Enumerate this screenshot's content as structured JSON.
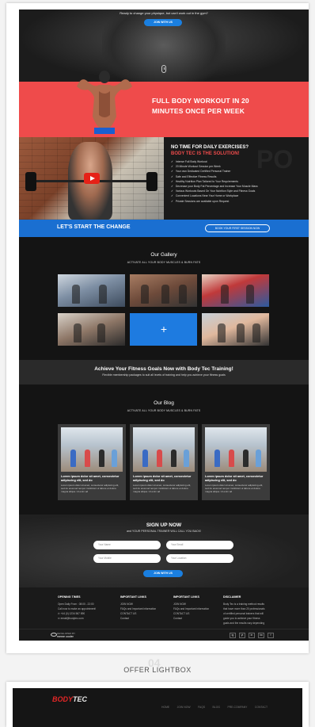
{
  "hero": {
    "subtitle": "Ready to change your physique, but can't work out in the gym?",
    "button": "JOIN WITH US"
  },
  "workout": {
    "title": "FULL BODY WORKOUT IN 20 MINUTES ONCE PER WEEK"
  },
  "notime": {
    "title": "NO TIME FOR DAILY EXERCISES?",
    "subtitle": "BODY TEC IS THE SOLUTION!",
    "bg_text": "PO",
    "items": [
      "Intense Full Body Workout",
      "20 Minute Workout Session per Week",
      "Your own Dedicated Certified Personal Trainer",
      "Safe and Effective Fitness Results",
      "Healthy Nutrition Plan Tailored to Your Requirements",
      "Decrease your Body Fat Percentage and Increase Your Muscle Mass",
      "Various Workouts Based On Your Nutrition Style and Fitness Goals",
      "Convenient Locations Near Your Home or Workplace",
      "Private Sessions are available upon Request"
    ]
  },
  "cta": {
    "title": "LET'S START THE CHANGE",
    "button": "BOOK YOUR FIRST SESSION NOW"
  },
  "gallery": {
    "title": "Our Gallery",
    "subtitle": "ACTIVATE ALL YOUR BODY MUSCLES & BURN FATS",
    "plus": "+"
  },
  "achieve": {
    "title": "Achieve Your Fitness Goals Now with Body Tec Training!",
    "subtitle": "Flexible membership packages to suit all levels of training and help you achieve your fitness goals"
  },
  "blog": {
    "title": "Our Blog",
    "subtitle": "ACTIVATE ALL YOUR BODY MUSCLES & BURN FATS",
    "cards": [
      {
        "title": "Lorem ipsum dolor sit amet, consectetur adipiscing elit, sed do",
        "text": "Lorem ipsum dolor sit amet, consectetur adipiscing elit, sed do eiusmod tempor incididunt ut labore et dolore magna aliqua. Ut enim ad"
      },
      {
        "title": "Lorem ipsum dolor sit amet, consectetur adipiscing elit, sed do",
        "text": "Lorem ipsum dolor sit amet, consectetur adipiscing elit, sed do eiusmod tempor incididunt ut labore et dolore magna aliqua. Ut enim ad"
      },
      {
        "title": "Lorem ipsum dolor sit amet, consectetur adipiscing elit, sed do",
        "text": "Lorem ipsum dolor sit amet, consectetur adipiscing elit, sed do eiusmod tempor incididunt ut labore et dolore magna aliqua. Ut enim ad"
      }
    ]
  },
  "signup": {
    "title": "SIGN UP NOW",
    "subtitle": "and YOUR PERSONAL TRAINER WILL CALL YOU BACK!",
    "fields": [
      "Your Name",
      "Your Email",
      "Your Mobile",
      "Your Location"
    ],
    "button": "JOIN WITH US"
  },
  "footer": {
    "opening": {
      "heading": "OPENING TIMES",
      "lines": [
        "Open Daily From : 08:00 - 22:00",
        "Call now to make an appointment!",
        "+44 (0) 1234 567 890",
        "email@bodytec.com"
      ]
    },
    "important": {
      "heading": "IMPORTANT LINKS",
      "lines": [
        "JOIN NOW",
        "FAQs and Important information",
        "CONTACT US",
        "Contact"
      ]
    },
    "important2": {
      "heading": "IMPORTANT LINKS",
      "lines": [
        "JOIN NOW",
        "FAQs and Important information",
        "CONTACT US",
        "Contact"
      ]
    },
    "disclaimer": {
      "heading": "DISCLAIMER",
      "lines": [
        "Body Tec is a training method results",
        "that have more than 20 professionals",
        "of certified personal trainers that will",
        "guide you to achieve your fitness",
        "goals and the results vary depending"
      ]
    },
    "developed_by": "DEVELOPED BY",
    "developer": "meme cooler",
    "social": [
      "ig",
      "yt",
      "in",
      "tw",
      "f"
    ]
  },
  "lightbox": {
    "number": "04",
    "title": "OFFER LIGHTBOX"
  },
  "preview": {
    "logo_red": "BODY",
    "logo_white": "TEC",
    "nav": [
      "HOME",
      "JOIN NOW",
      "FAQS",
      "BLOG",
      "PRE-COMPANY",
      "CONTACT"
    ]
  },
  "colors": {
    "accent_red": "#ef4b4b",
    "accent_blue": "#1a6fd1",
    "dark_bg": "#141414"
  }
}
